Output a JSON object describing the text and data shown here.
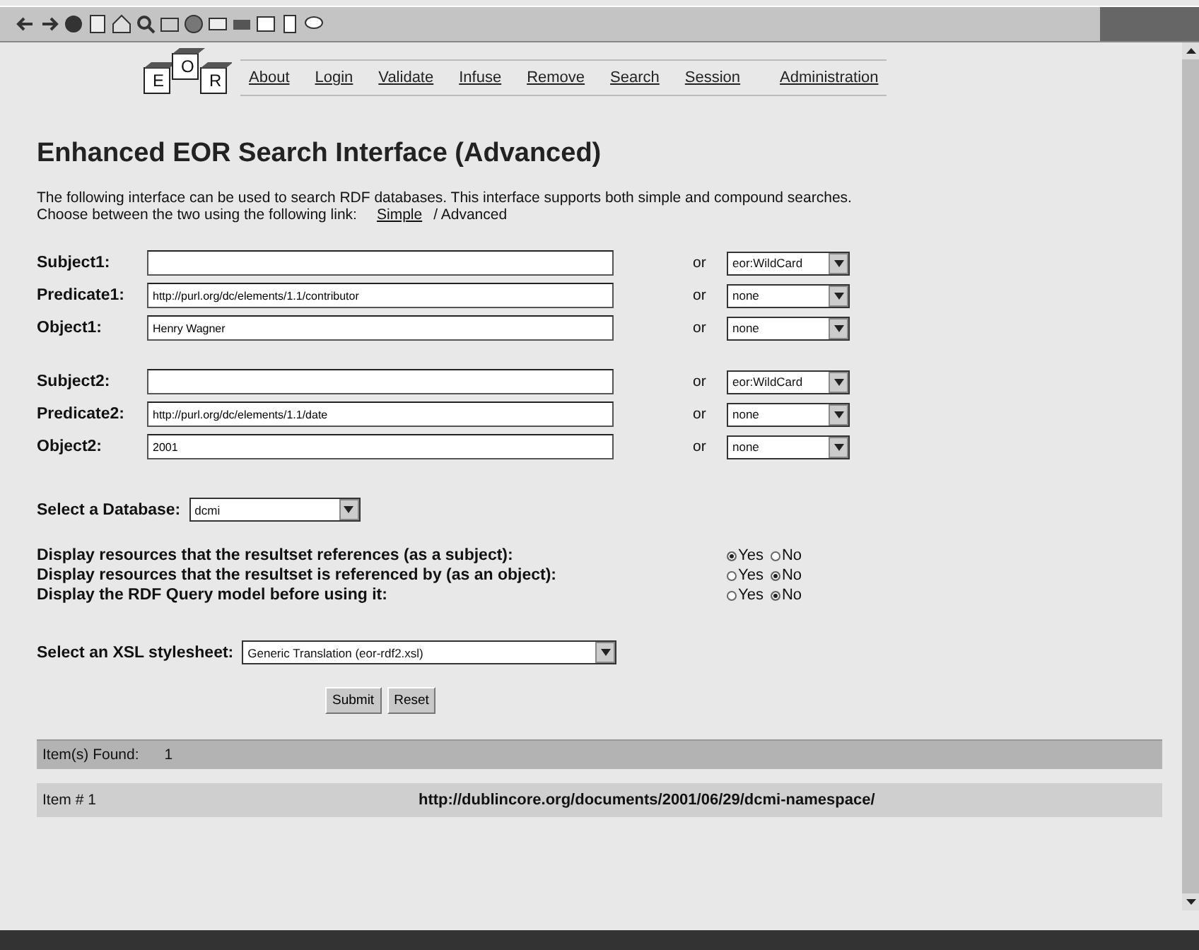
{
  "logo_letters": [
    "E",
    "O",
    "R"
  ],
  "nav": [
    "About",
    "Login",
    "Validate",
    "Infuse",
    "Remove",
    "Search",
    "Session",
    "Administration"
  ],
  "title": "Enhanced EOR Search Interface (Advanced)",
  "intro": "The following interface can be used to search RDF databases. This interface supports both simple and compound searches.",
  "switch": {
    "text": "Choose between the two using the following link:",
    "link": "Simple",
    "current": "/ Advanced"
  },
  "query_groups": [
    [
      {
        "label": "Subject1:",
        "or": "or",
        "select": "eor:WildCard"
      },
      {
        "label": "Predicate1:",
        "value": "http://purl.org/dc/elements/1.1/contributor",
        "or": "or",
        "select": "none"
      },
      {
        "label": "Object1:",
        "value": "Henry Wagner",
        "or": "or",
        "select": "none"
      }
    ],
    [
      {
        "label": "Subject2:",
        "or": "or",
        "select": "eor:WildCard"
      },
      {
        "label": "Predicate2:",
        "value": "http://purl.org/dc/elements/1.1/date",
        "or": "or",
        "select": "none"
      },
      {
        "label": "Object2:",
        "value": "2001",
        "or": "or",
        "select": "none"
      }
    ]
  ],
  "database": {
    "label": "Select a Database:",
    "value": "dcmi"
  },
  "options": [
    {
      "label": "Display resources that the resultset references (as a subject):",
      "choices": [
        {
          "label": "Yes",
          "selected": true
        },
        {
          "label": "No",
          "selected": false
        }
      ]
    },
    {
      "label": "Display resources that the resultset is referenced by (as an object):",
      "choices": [
        {
          "label": "Yes",
          "selected": false
        },
        {
          "label": "No",
          "selected": true
        }
      ]
    },
    {
      "label": "Display the RDF Query model before using it:",
      "choices": [
        {
          "label": "Yes",
          "selected": false
        },
        {
          "label": "No",
          "selected": true
        }
      ]
    }
  ],
  "stylesheet": {
    "label": "Select an XSL stylesheet:",
    "value": "Generic Translation (eor-rdf2.xsl)"
  },
  "buttons": [
    "Submit",
    "Reset"
  ],
  "found": {
    "label": "Item(s) Found:",
    "count": "1"
  },
  "results": [
    {
      "label": "Item # 1",
      "url": "http://dublincore.org/documents/2001/06/29/dcmi-namespace/"
    }
  ]
}
